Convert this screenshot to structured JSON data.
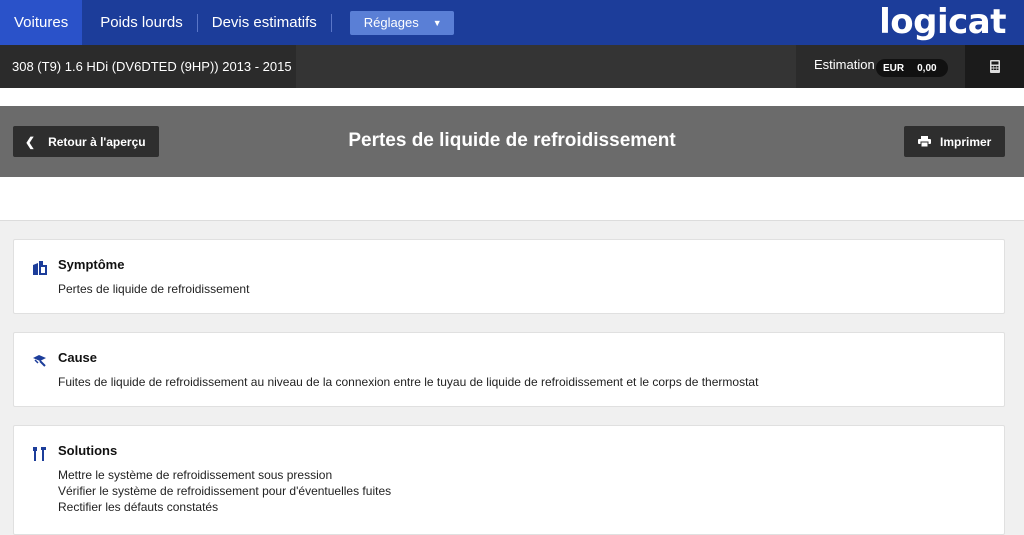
{
  "nav": {
    "items": [
      {
        "label": "Voitures",
        "active": true
      },
      {
        "label": "Poids lourds",
        "active": false
      },
      {
        "label": "Devis estimatifs",
        "active": false
      }
    ],
    "settings_label": "Réglages",
    "logo": "logicat"
  },
  "vehicle": {
    "name": "308 (T9) 1.6 HDi (DV6DTED (9HP)) 2013 - 2015"
  },
  "estimation": {
    "label": "Estimation",
    "currency": "EUR",
    "amount": "0,00"
  },
  "header": {
    "back_label": "Retour à l'aperçu",
    "title": "Pertes de liquide de refroidissement",
    "print_label": "Imprimer"
  },
  "cards": {
    "symptom": {
      "title": "Symptôme",
      "text": "Pertes de liquide de refroidissement",
      "icon": "symptom-icon"
    },
    "cause": {
      "title": "Cause",
      "text": "Fuites de liquide de refroidissement au niveau de la connexion entre le tuyau de liquide de refroidissement et le corps de thermostat",
      "icon": "flag-icon"
    },
    "solutions": {
      "title": "Solutions",
      "lines": [
        "Mettre le système de refroidissement sous pression",
        "Vérifier le système de refroidissement pour d'éventuelles fuites",
        "Rectifier les défauts constatés"
      ],
      "icon": "tools-icon"
    }
  },
  "colors": {
    "nav_bg": "#1c3d9a",
    "nav_active": "#2a52c9",
    "accent_icon": "#1c3d9a",
    "title_band": "#6b6b6b"
  }
}
